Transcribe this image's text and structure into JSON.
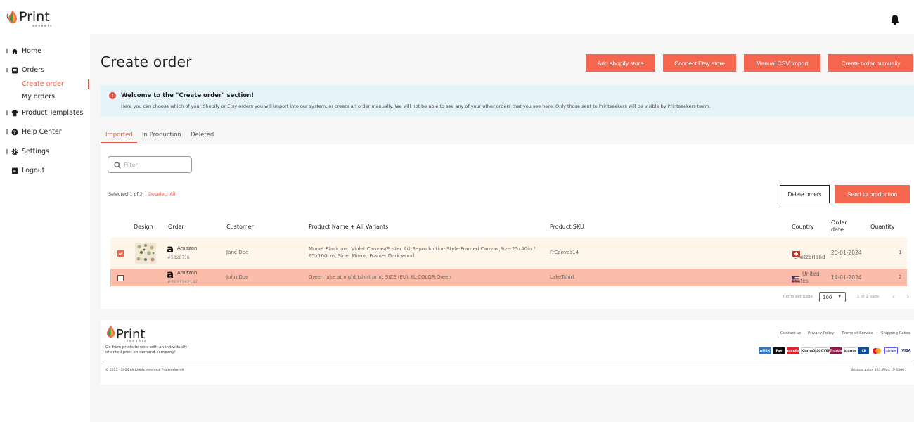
{
  "app": {
    "logo_word": "Print",
    "logo_sub": "seekers",
    "left_glyph": "("
  },
  "sidebar": {
    "items": [
      {
        "label": "Home",
        "icon": "home-icon"
      },
      {
        "label": "Orders",
        "icon": "orders-icon"
      },
      {
        "label": "Product Templates",
        "icon": "tshirt-icon"
      },
      {
        "label": "Help Center",
        "icon": "help-icon"
      },
      {
        "label": "Settings",
        "icon": "gear-icon"
      },
      {
        "label": "Logout",
        "icon": "logout-icon"
      }
    ],
    "orders_sub": [
      {
        "label": "Create order",
        "active": true
      },
      {
        "label": "My orders",
        "active": false
      }
    ]
  },
  "header": {
    "title": "Create order",
    "buttons": [
      "Add shopify store",
      "Connect Etsy store",
      "Manual CSV Import",
      "Create order manually"
    ]
  },
  "notice": {
    "icon": "exclamation-icon",
    "title": "Welcome to the \"Create order\" section!",
    "body": "Here you can choose which of your Shopify or Etsy orders you will import into our system, or create an order manually. We will not be able to see any of your other orders that you see here. Only those sent to Printseekers will be visible by Printseekers team."
  },
  "tabs": [
    "Imported",
    "In Production",
    "Deleted"
  ],
  "filter": {
    "placeholder": "Filter"
  },
  "selection": {
    "text": "Selected 1 of 2",
    "deselect_label": "Deselect All"
  },
  "actions": {
    "delete_label": "Delete orders",
    "send_label": "Send to production"
  },
  "table": {
    "columns": [
      "Design",
      "Order",
      "Customer",
      "Product Name + All Variants",
      "Product SKU",
      "Country",
      "Order date",
      "Quantity"
    ],
    "rows": [
      {
        "checked": true,
        "store": "Amazon",
        "order_no": "#5328716",
        "customer": "Jane Doe",
        "product": "Monet Black and Violet Canvas/Poster Art Reproduction Style:Framed Canvas,Size:25x40in /",
        "product_line2": "65x100cm, Side: Mirror, Frame: Dark wood",
        "sku": "FrCanvas14",
        "country": "Switzerland",
        "date": "25-01-2024",
        "quantity": "1"
      },
      {
        "checked": false,
        "store": "Amazon",
        "order_no": "#3237162147",
        "customer": "John Doe",
        "product": "Green lake at night tshirt print SIZE (EU):XL;COLOR:Green",
        "product_line2": "",
        "sku": "LakeTshirt",
        "country_line1": "United",
        "country_line2": "States",
        "date": "14-01-2024",
        "quantity": "2"
      }
    ]
  },
  "pagination": {
    "items_label": "Items per page:",
    "per_page": "100",
    "page_info": "1 of 1 page"
  },
  "footer": {
    "tagline": "Go from prints to wins with an individually oriented print on demand company!",
    "links": [
      "Contact us",
      "Privacy Policy",
      "Terms of Service",
      "Shipping Rates"
    ],
    "payments": [
      "AMEX",
      "Pay",
      "UnionPay",
      "Klarna",
      "DISCOVER",
      "Trustly",
      "klarna",
      "JCB",
      "MC",
      "stripe",
      "VISA"
    ],
    "copyright": "© 2013 - 2024 All Rights reserved. Printseekers®",
    "address": "Brivibas gatve 323, Riga, LV-1006"
  },
  "colors": {
    "accent": "#f4674e",
    "notice_bg": "#e7f3fb",
    "row_selected": "#fff5ea",
    "row_highlight": "#fbbcaa"
  }
}
